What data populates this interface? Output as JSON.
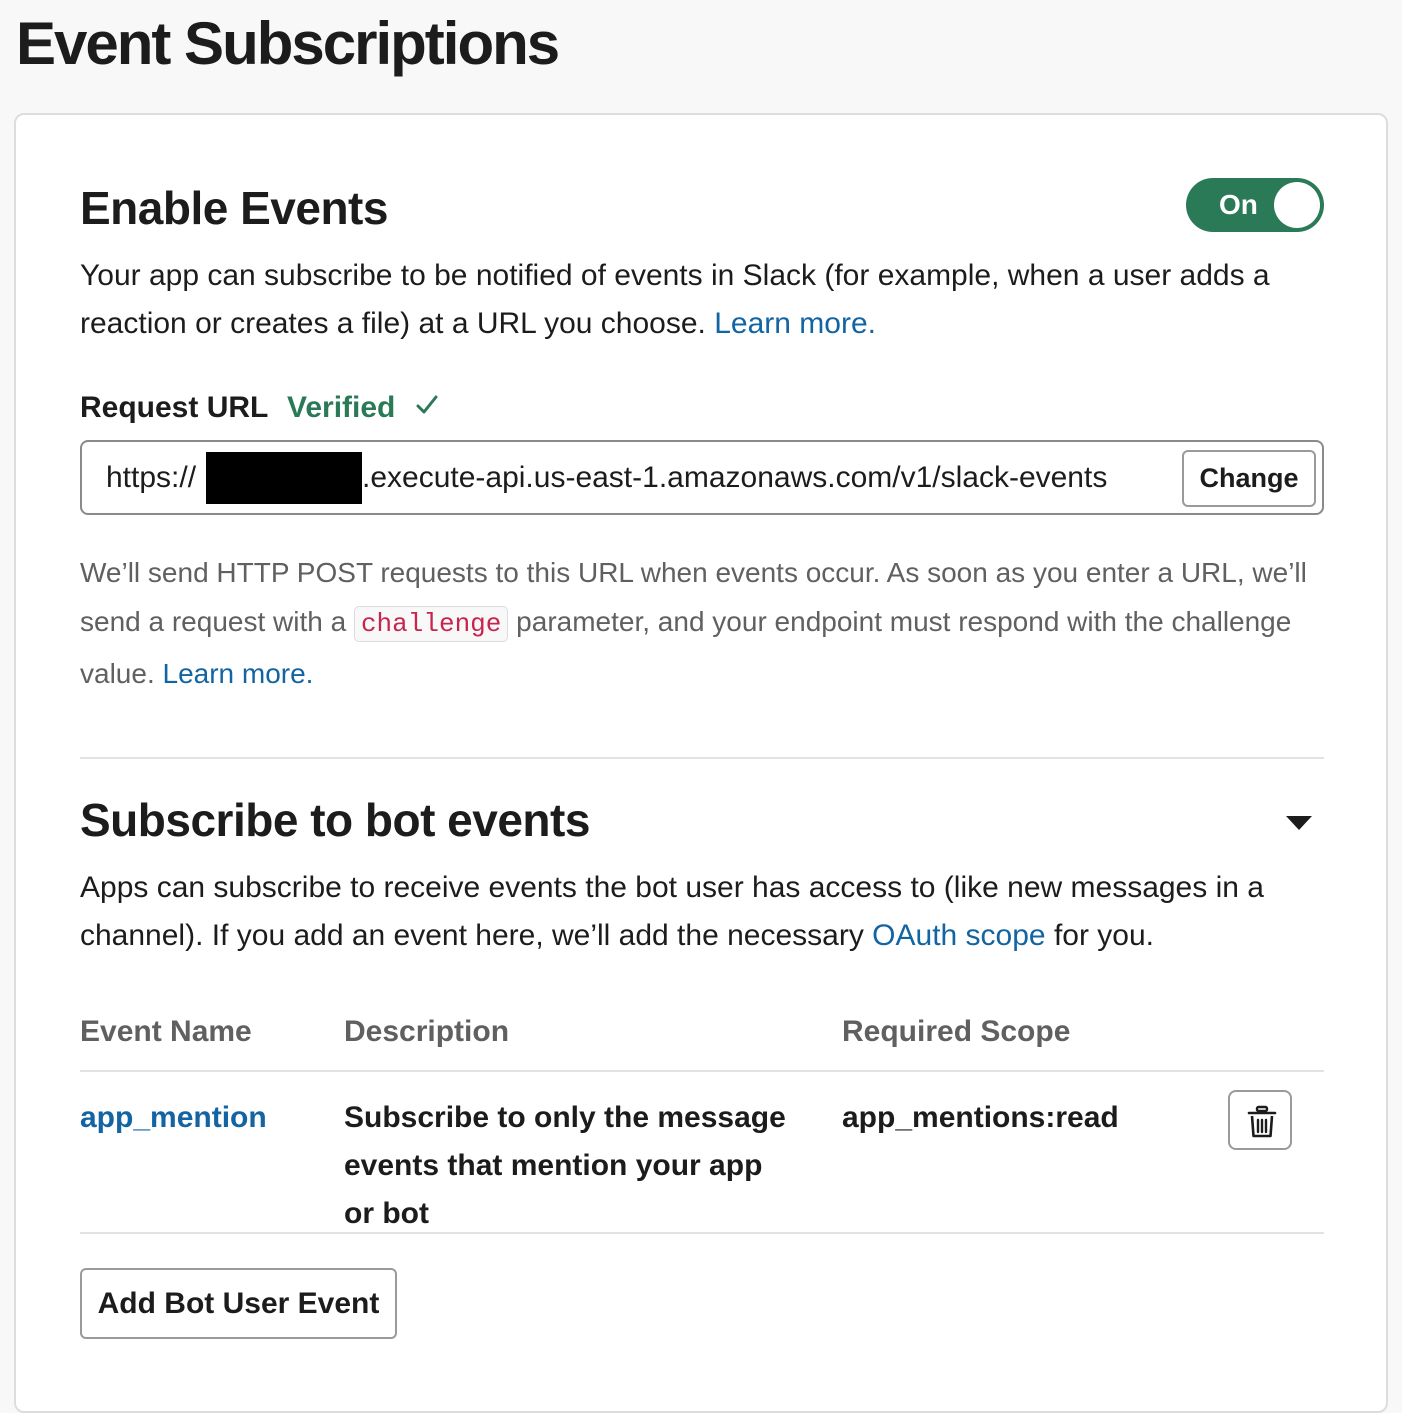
{
  "page": {
    "title": "Event Subscriptions"
  },
  "enable_events": {
    "title": "Enable Events",
    "toggle_label": "On",
    "description": "Your app can subscribe to be notified of events in Slack (for example, when a user adds a reaction or creates a file) at a URL you choose.",
    "learn_more": "Learn more."
  },
  "request_url": {
    "label": "Request URL",
    "status": "Verified",
    "url_prefix": "https://",
    "url_suffix": ".execute-api.us-east-1.amazonaws.com/v1/slack-events",
    "change_label": "Change",
    "help_part1": "We’ll send HTTP POST requests to this URL when events occur. As soon as you enter a URL, we’ll send a request with a",
    "help_code": "challenge",
    "help_part2": "parameter, and your endpoint must respond with the challenge value.",
    "help_learn_more": "Learn more."
  },
  "bot_events": {
    "title": "Subscribe to bot events",
    "description_part1": "Apps can subscribe to receive events the bot user has access to (like new messages in a channel). If you add an event here, we’ll add the necessary",
    "oauth_link": "OAuth scope",
    "description_part2": "for you.",
    "columns": {
      "name": "Event Name",
      "description": "Description",
      "scope": "Required Scope"
    },
    "rows": [
      {
        "name": "app_mention",
        "description": "Subscribe to only the message events that mention your app or bot",
        "scope": "app_mentions:read"
      }
    ],
    "add_button": "Add Bot User Event"
  },
  "colors": {
    "toggle_on": "#2b7a57",
    "verified": "#2b7a57",
    "link": "#1264a3",
    "code_text": "#c7254e",
    "muted_text": "#616061"
  },
  "icons": {
    "verified": "checkmark-icon",
    "collapse": "caret-down-icon",
    "delete": "trash-icon"
  }
}
